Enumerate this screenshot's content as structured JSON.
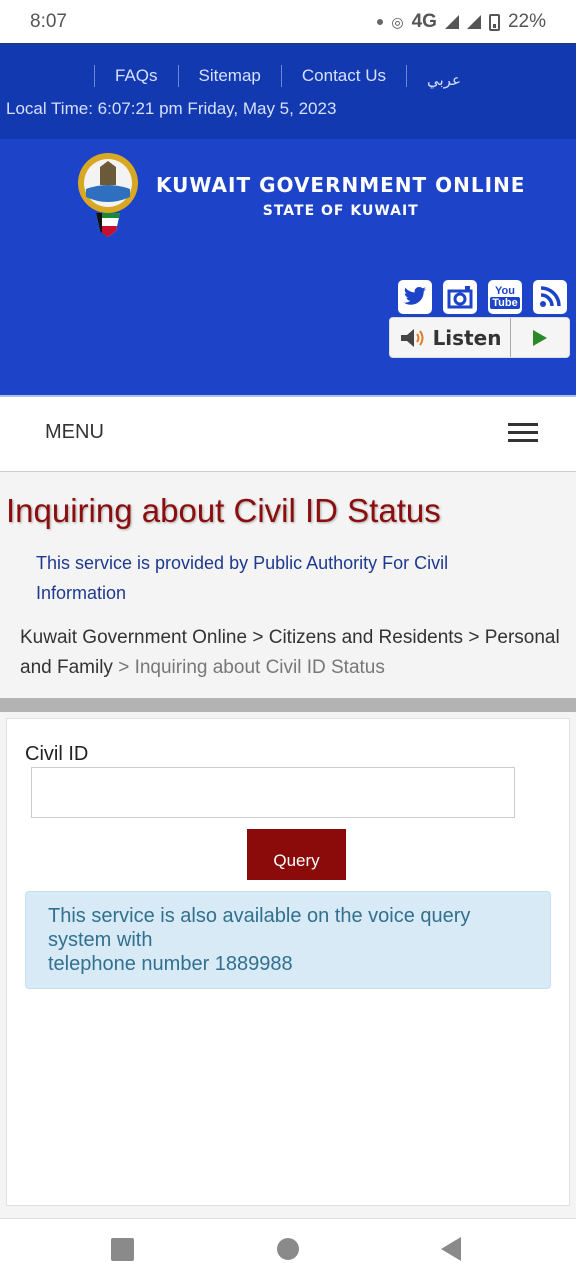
{
  "status_bar": {
    "time": "8:07",
    "network": "4G",
    "battery": "22%",
    "icons": [
      "notification-dot-icon",
      "hotspot-icon",
      "signal-icon",
      "signal-icon",
      "battery-charging-icon"
    ]
  },
  "top_links": {
    "items": [
      {
        "label": "FAQs"
      },
      {
        "label": "Sitemap"
      },
      {
        "label": "Contact Us"
      },
      {
        "label": "عربي"
      }
    ],
    "local_time": "Local Time: 6:07:21 pm Friday, May 5, 2023"
  },
  "header": {
    "title": "KUWAIT GOVERNMENT ONLINE",
    "subtitle": "STATE OF KUWAIT",
    "social": [
      {
        "name": "twitter-icon",
        "glyph": "🐦"
      },
      {
        "name": "instagram-icon",
        "glyph": "◙"
      },
      {
        "name": "youtube-icon",
        "glyph": "You Tube"
      },
      {
        "name": "rss-icon",
        "glyph": "◠"
      }
    ],
    "listen_label": "Listen"
  },
  "menu": {
    "label": "MENU"
  },
  "page": {
    "title": "Inquiring about Civil ID Status",
    "provided_by": "This service is provided by Public Authority For Civil Information",
    "breadcrumb": [
      {
        "label": "Kuwait Government Online"
      },
      {
        "label": "Citizens and Residents"
      },
      {
        "label": "Personal and Family"
      },
      {
        "label": "Inquiring about Civil ID Status"
      }
    ],
    "breadcrumb_sep": " > "
  },
  "form": {
    "civil_id_label": "Civil ID",
    "civil_id_value": "",
    "query_label": "Query",
    "info_line1": "This service is also available on the voice query system with",
    "info_line2": "telephone number 1889988"
  },
  "colors": {
    "header_blue": "#1c43c8",
    "title_red": "#8b0d0d",
    "query_button": "#8b0a0a",
    "info_bg": "#d8eaf5"
  }
}
